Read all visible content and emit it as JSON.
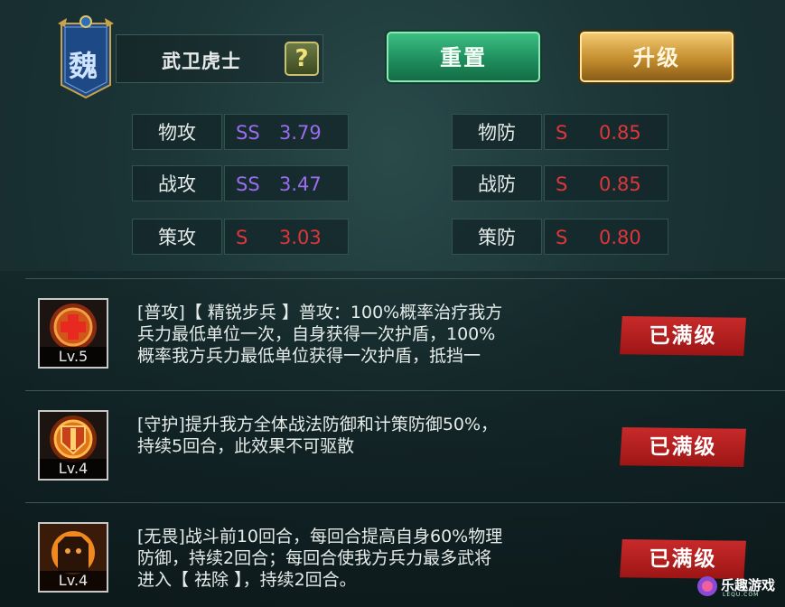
{
  "faction": {
    "char": "魏"
  },
  "unit": {
    "name": "武卫虎士",
    "help_label": "?"
  },
  "buttons": {
    "reset": "重置",
    "upgrade": "升级"
  },
  "stats": [
    {
      "label": "物攻",
      "grade": "SS",
      "value": "3.79",
      "color": "#9b6cf0"
    },
    {
      "label": "战攻",
      "grade": "SS",
      "value": "3.47",
      "color": "#9b6cf0"
    },
    {
      "label": "策攻",
      "grade": "S",
      "value": "3.03",
      "color": "#e0353a"
    },
    {
      "label": "物防",
      "grade": "S",
      "value": "0.85",
      "color": "#e0353a"
    },
    {
      "label": "战防",
      "grade": "S",
      "value": "0.85",
      "color": "#e0353a"
    },
    {
      "label": "策防",
      "grade": "S",
      "value": "0.80",
      "color": "#e0353a"
    }
  ],
  "skills": [
    {
      "level": "Lv.5",
      "icon": "medic-cross-icon",
      "lines": [
        "[普攻]【 精锐步兵 】普攻：100%概率治疗我方",
        "兵力最低单位一次，自身获得一次护盾，100%",
        "概率我方兵力最低单位获得一次护盾，抵挡一"
      ],
      "status": "已满级"
    },
    {
      "level": "Lv.4",
      "icon": "guard-shield-icon",
      "lines": [
        "[守护]提升我方全体战法防御和计策防御50%，",
        "持续5回合，此效果不可驱散"
      ],
      "status": "已满级"
    },
    {
      "level": "Lv.4",
      "icon": "fearless-warrior-icon",
      "lines": [
        "[无畏]战斗前10回合，每回合提高自身60%物理",
        "防御，持续2回合；每回合使我方兵力最多武将",
        "进入【 祛除 】，持续2回合。"
      ],
      "status": "已满级"
    }
  ],
  "watermark": {
    "text": "乐趣游戏",
    "sub": "LEQU.COM"
  }
}
